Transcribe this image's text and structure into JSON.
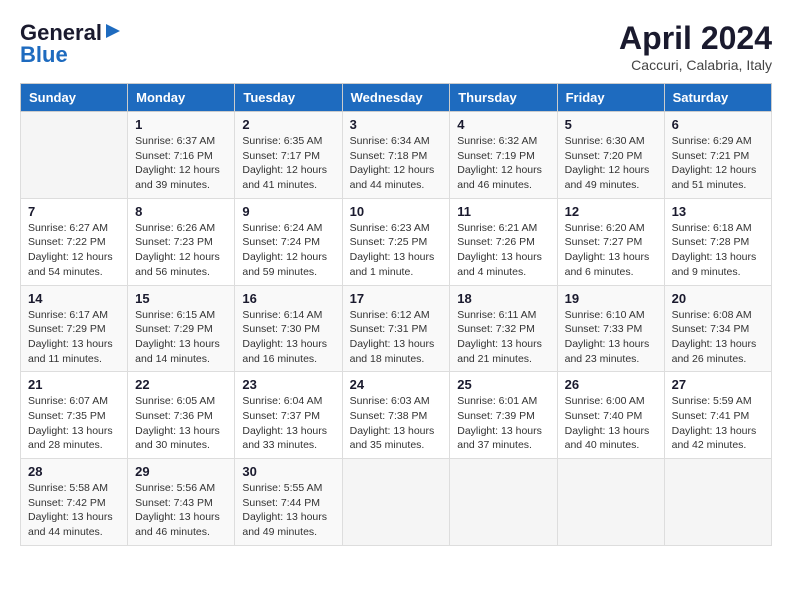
{
  "logo": {
    "general": "General",
    "blue": "Blue"
  },
  "title": "April 2024",
  "location": "Caccuri, Calabria, Italy",
  "days_of_week": [
    "Sunday",
    "Monday",
    "Tuesday",
    "Wednesday",
    "Thursday",
    "Friday",
    "Saturday"
  ],
  "weeks": [
    [
      {
        "day": "",
        "sunrise": "",
        "sunset": "",
        "daylight": ""
      },
      {
        "day": "1",
        "sunrise": "Sunrise: 6:37 AM",
        "sunset": "Sunset: 7:16 PM",
        "daylight": "Daylight: 12 hours and 39 minutes."
      },
      {
        "day": "2",
        "sunrise": "Sunrise: 6:35 AM",
        "sunset": "Sunset: 7:17 PM",
        "daylight": "Daylight: 12 hours and 41 minutes."
      },
      {
        "day": "3",
        "sunrise": "Sunrise: 6:34 AM",
        "sunset": "Sunset: 7:18 PM",
        "daylight": "Daylight: 12 hours and 44 minutes."
      },
      {
        "day": "4",
        "sunrise": "Sunrise: 6:32 AM",
        "sunset": "Sunset: 7:19 PM",
        "daylight": "Daylight: 12 hours and 46 minutes."
      },
      {
        "day": "5",
        "sunrise": "Sunrise: 6:30 AM",
        "sunset": "Sunset: 7:20 PM",
        "daylight": "Daylight: 12 hours and 49 minutes."
      },
      {
        "day": "6",
        "sunrise": "Sunrise: 6:29 AM",
        "sunset": "Sunset: 7:21 PM",
        "daylight": "Daylight: 12 hours and 51 minutes."
      }
    ],
    [
      {
        "day": "7",
        "sunrise": "Sunrise: 6:27 AM",
        "sunset": "Sunset: 7:22 PM",
        "daylight": "Daylight: 12 hours and 54 minutes."
      },
      {
        "day": "8",
        "sunrise": "Sunrise: 6:26 AM",
        "sunset": "Sunset: 7:23 PM",
        "daylight": "Daylight: 12 hours and 56 minutes."
      },
      {
        "day": "9",
        "sunrise": "Sunrise: 6:24 AM",
        "sunset": "Sunset: 7:24 PM",
        "daylight": "Daylight: 12 hours and 59 minutes."
      },
      {
        "day": "10",
        "sunrise": "Sunrise: 6:23 AM",
        "sunset": "Sunset: 7:25 PM",
        "daylight": "Daylight: 13 hours and 1 minute."
      },
      {
        "day": "11",
        "sunrise": "Sunrise: 6:21 AM",
        "sunset": "Sunset: 7:26 PM",
        "daylight": "Daylight: 13 hours and 4 minutes."
      },
      {
        "day": "12",
        "sunrise": "Sunrise: 6:20 AM",
        "sunset": "Sunset: 7:27 PM",
        "daylight": "Daylight: 13 hours and 6 minutes."
      },
      {
        "day": "13",
        "sunrise": "Sunrise: 6:18 AM",
        "sunset": "Sunset: 7:28 PM",
        "daylight": "Daylight: 13 hours and 9 minutes."
      }
    ],
    [
      {
        "day": "14",
        "sunrise": "Sunrise: 6:17 AM",
        "sunset": "Sunset: 7:29 PM",
        "daylight": "Daylight: 13 hours and 11 minutes."
      },
      {
        "day": "15",
        "sunrise": "Sunrise: 6:15 AM",
        "sunset": "Sunset: 7:29 PM",
        "daylight": "Daylight: 13 hours and 14 minutes."
      },
      {
        "day": "16",
        "sunrise": "Sunrise: 6:14 AM",
        "sunset": "Sunset: 7:30 PM",
        "daylight": "Daylight: 13 hours and 16 minutes."
      },
      {
        "day": "17",
        "sunrise": "Sunrise: 6:12 AM",
        "sunset": "Sunset: 7:31 PM",
        "daylight": "Daylight: 13 hours and 18 minutes."
      },
      {
        "day": "18",
        "sunrise": "Sunrise: 6:11 AM",
        "sunset": "Sunset: 7:32 PM",
        "daylight": "Daylight: 13 hours and 21 minutes."
      },
      {
        "day": "19",
        "sunrise": "Sunrise: 6:10 AM",
        "sunset": "Sunset: 7:33 PM",
        "daylight": "Daylight: 13 hours and 23 minutes."
      },
      {
        "day": "20",
        "sunrise": "Sunrise: 6:08 AM",
        "sunset": "Sunset: 7:34 PM",
        "daylight": "Daylight: 13 hours and 26 minutes."
      }
    ],
    [
      {
        "day": "21",
        "sunrise": "Sunrise: 6:07 AM",
        "sunset": "Sunset: 7:35 PM",
        "daylight": "Daylight: 13 hours and 28 minutes."
      },
      {
        "day": "22",
        "sunrise": "Sunrise: 6:05 AM",
        "sunset": "Sunset: 7:36 PM",
        "daylight": "Daylight: 13 hours and 30 minutes."
      },
      {
        "day": "23",
        "sunrise": "Sunrise: 6:04 AM",
        "sunset": "Sunset: 7:37 PM",
        "daylight": "Daylight: 13 hours and 33 minutes."
      },
      {
        "day": "24",
        "sunrise": "Sunrise: 6:03 AM",
        "sunset": "Sunset: 7:38 PM",
        "daylight": "Daylight: 13 hours and 35 minutes."
      },
      {
        "day": "25",
        "sunrise": "Sunrise: 6:01 AM",
        "sunset": "Sunset: 7:39 PM",
        "daylight": "Daylight: 13 hours and 37 minutes."
      },
      {
        "day": "26",
        "sunrise": "Sunrise: 6:00 AM",
        "sunset": "Sunset: 7:40 PM",
        "daylight": "Daylight: 13 hours and 40 minutes."
      },
      {
        "day": "27",
        "sunrise": "Sunrise: 5:59 AM",
        "sunset": "Sunset: 7:41 PM",
        "daylight": "Daylight: 13 hours and 42 minutes."
      }
    ],
    [
      {
        "day": "28",
        "sunrise": "Sunrise: 5:58 AM",
        "sunset": "Sunset: 7:42 PM",
        "daylight": "Daylight: 13 hours and 44 minutes."
      },
      {
        "day": "29",
        "sunrise": "Sunrise: 5:56 AM",
        "sunset": "Sunset: 7:43 PM",
        "daylight": "Daylight: 13 hours and 46 minutes."
      },
      {
        "day": "30",
        "sunrise": "Sunrise: 5:55 AM",
        "sunset": "Sunset: 7:44 PM",
        "daylight": "Daylight: 13 hours and 49 minutes."
      },
      {
        "day": "",
        "sunrise": "",
        "sunset": "",
        "daylight": ""
      },
      {
        "day": "",
        "sunrise": "",
        "sunset": "",
        "daylight": ""
      },
      {
        "day": "",
        "sunrise": "",
        "sunset": "",
        "daylight": ""
      },
      {
        "day": "",
        "sunrise": "",
        "sunset": "",
        "daylight": ""
      }
    ]
  ]
}
